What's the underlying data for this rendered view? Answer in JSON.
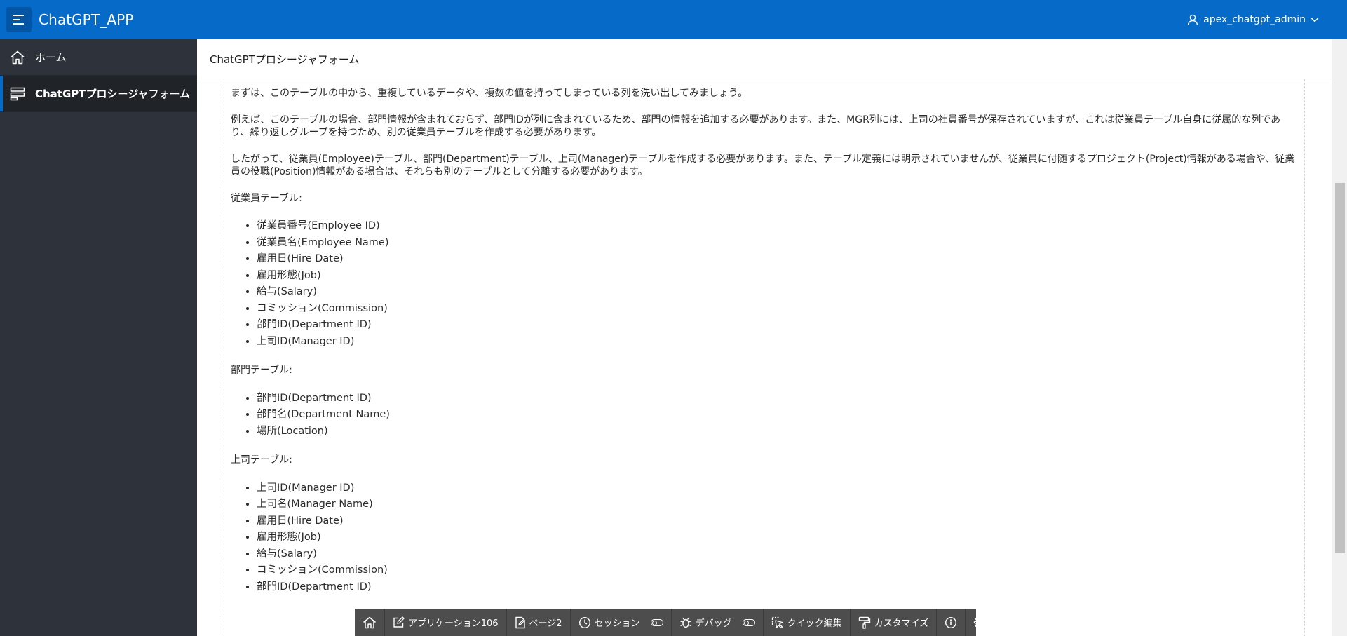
{
  "header": {
    "app_title": "ChatGPT_APP",
    "user_name": "apex_chatgpt_admin"
  },
  "sidebar": {
    "items": [
      {
        "label": "ホーム",
        "icon": "home-icon",
        "active": false
      },
      {
        "label": "ChatGPTプロシージャフォーム",
        "icon": "form-list-icon",
        "active": true
      }
    ]
  },
  "page": {
    "breadcrumb": "ChatGPTプロシージャフォーム"
  },
  "content": {
    "para1": "まずは、このテーブルの中から、重複しているデータや、複数の値を持ってしまっている列を洗い出してみましょう。",
    "para2": "例えば、このテーブルの場合、部門情報が含まれておらず、部門IDが列に含まれているため、部門の情報を追加する必要があります。また、MGR列には、上司の社員番号が保存されていますが、これは従業員テーブル自身に従属的な列であり、繰り返しグループを持つため、別の従業員テーブルを作成する必要があります。",
    "para3": "したがって、従業員(Employee)テーブル、部門(Department)テーブル、上司(Manager)テーブルを作成する必要があります。また、テーブル定義には明示されていませんが、従業員に付随するプロジェクト(Project)情報がある場合や、従業員の役職(Position)情報がある場合は、それらも別のテーブルとして分離する必要があります。",
    "employee_heading": "従業員テーブル:",
    "employee_items": [
      "従業員番号(Employee ID)",
      "従業員名(Employee Name)",
      "雇用日(Hire Date)",
      "雇用形態(Job)",
      "給与(Salary)",
      "コミッション(Commission)",
      "部門ID(Department ID)",
      "上司ID(Manager ID)"
    ],
    "department_heading": "部門テーブル:",
    "department_items": [
      "部門ID(Department ID)",
      "部門名(Department Name)",
      "場所(Location)"
    ],
    "manager_heading": "上司テーブル:",
    "manager_items": [
      "上司ID(Manager ID)",
      "上司名(Manager Name)",
      "雇用日(Hire Date)",
      "雇用形態(Job)",
      "給与(Salary)",
      "コミッション(Commission)",
      "部門ID(Department ID)"
    ]
  },
  "devbar": {
    "application": "アプリケーション106",
    "page": "ページ2",
    "session": "セッション",
    "debug": "デバッグ",
    "quick_edit": "クイック編集",
    "customize": "カスタマイズ"
  },
  "colors": {
    "header_bg": "#056ac8",
    "sidebar_bg": "#2e333b",
    "devbar_bg": "#4d4d4d"
  }
}
